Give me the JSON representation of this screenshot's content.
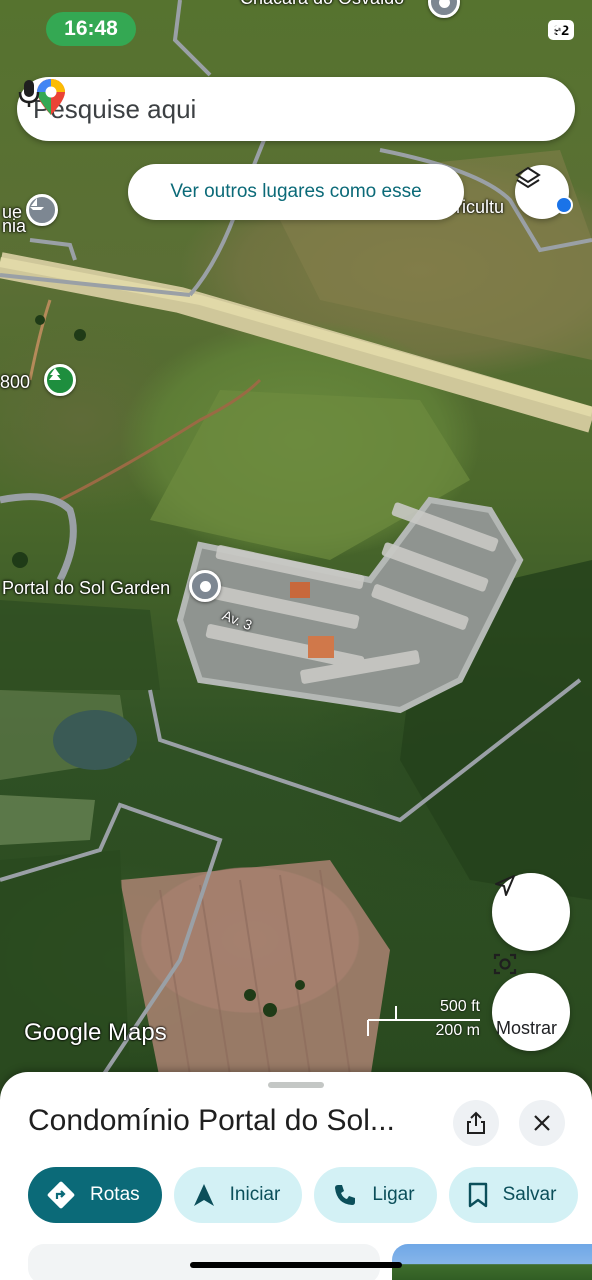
{
  "status_bar": {
    "time": "16:48",
    "battery": "92"
  },
  "search": {
    "placeholder": "Pesquise aqui"
  },
  "suggestion_chip": "Ver outros lugares como esse",
  "map_labels": {
    "top_partial": "Chacara do Osvaldo",
    "left_partial_1": "ue",
    "left_partial_2": "nia",
    "right_partial": "oricultu",
    "number_800": "800",
    "portal_do_sol": "Portal do Sol Garden",
    "av3": "Av. 3"
  },
  "map_branding": "Google Maps",
  "scale": {
    "feet": "500 ft",
    "meters": "200 m"
  },
  "mostrar_label": "Mostrar",
  "place": {
    "title": "Condomínio Portal do Sol..."
  },
  "actions": [
    {
      "label": "Rotas",
      "icon": "directions-icon"
    },
    {
      "label": "Iniciar",
      "icon": "navigation-arrow-icon"
    },
    {
      "label": "Ligar",
      "icon": "phone-icon"
    },
    {
      "label": "Salvar",
      "icon": "bookmark-icon"
    }
  ],
  "colors": {
    "accent": "#0b6a78",
    "chip": "#d3f1f5",
    "status_green": "#34a853"
  }
}
